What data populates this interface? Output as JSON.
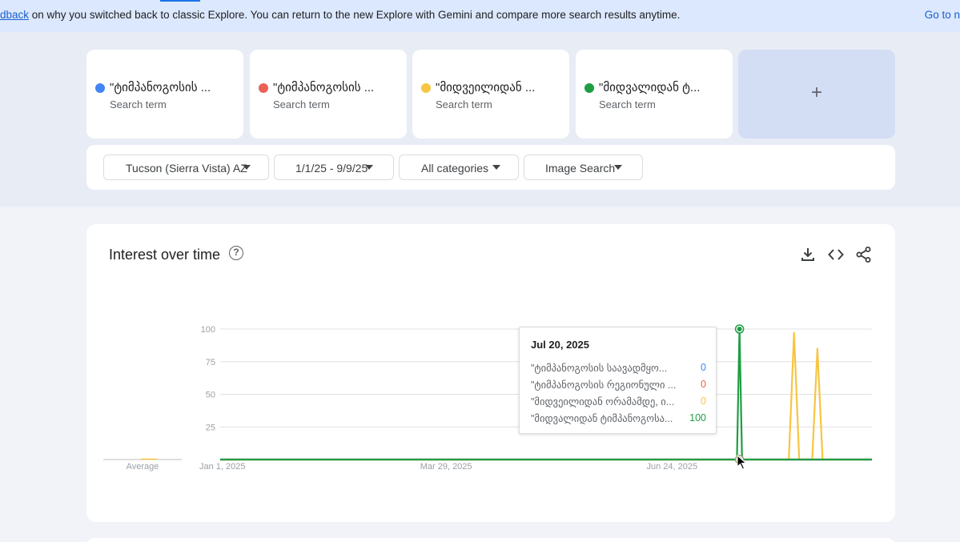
{
  "banner": {
    "link_text": "dback",
    "message": " on why you switched back to classic Explore. You can return to the new Explore with Gemini and compare more search results anytime.",
    "right_link": "Go to n"
  },
  "terms": [
    {
      "name": "\"ტიმპანოგოსის ...",
      "type": "Search term",
      "color": "#4285f4"
    },
    {
      "name": "\"ტიმპანოგოსის ...",
      "type": "Search term",
      "color": "#ea6257"
    },
    {
      "name": "\"მიდვეილიდან ...",
      "type": "Search term",
      "color": "#f7c542"
    },
    {
      "name": "\"მიდვალიდან ტ...",
      "type": "Search term",
      "color": "#1e9e43"
    }
  ],
  "add_term": {
    "icon": "plus-icon",
    "label": "+"
  },
  "filters": {
    "location": "Tucson (Sierra Vista) AZ",
    "date_range": "1/1/25 - 9/9/25",
    "category": "All categories",
    "search_type": "Image Search"
  },
  "interest": {
    "title": "Interest over time",
    "help_symbol": "?",
    "icons": [
      "download-icon",
      "embed-icon",
      "share-icon"
    ],
    "average_label": "Average"
  },
  "chart_data": {
    "type": "line",
    "title": "Interest over time",
    "ylim": [
      0,
      100
    ],
    "yticks": [
      25,
      50,
      75,
      100
    ],
    "xlim": [
      "2025-01-01",
      "2025-09-09"
    ],
    "xticks": [
      {
        "date": "2025-01-01",
        "label": "Jan 1, 2025"
      },
      {
        "date": "2025-03-29",
        "label": "Mar 29, 2025"
      },
      {
        "date": "2025-06-24",
        "label": "Jun 24, 2025"
      }
    ],
    "grid": true,
    "series": [
      {
        "name": "\"ტიმპანოგოსის საავადმყო...",
        "color": "#4285f4",
        "points": [
          [
            "2025-01-01",
            0
          ],
          [
            "2025-09-09",
            0
          ]
        ]
      },
      {
        "name": "\"ტიმპანოგოსის რეგიონული ...",
        "color": "#ea6257",
        "points": [
          [
            "2025-01-01",
            0
          ],
          [
            "2025-09-09",
            0
          ]
        ]
      },
      {
        "name": "\"მიდვეილიდან ორამამდე, ი...",
        "color": "#f7c542",
        "points": [
          [
            "2025-01-01",
            0
          ],
          [
            "2025-08-08",
            0
          ],
          [
            "2025-08-10",
            97
          ],
          [
            "2025-08-12",
            0
          ],
          [
            "2025-08-17",
            0
          ],
          [
            "2025-08-19",
            85
          ],
          [
            "2025-08-21",
            0
          ],
          [
            "2025-09-09",
            0
          ]
        ]
      },
      {
        "name": "\"მიდვალიდან ტიმპანოგოსა...",
        "color": "#1e9e43",
        "points": [
          [
            "2025-01-01",
            0
          ],
          [
            "2025-07-19",
            0
          ],
          [
            "2025-07-20",
            100
          ],
          [
            "2025-07-21",
            0
          ],
          [
            "2025-09-09",
            0
          ]
        ]
      }
    ],
    "tooltip": {
      "date": "Jul 20, 2025",
      "rows": [
        {
          "name": "\"ტიმპანოგოსის საავადმყო...",
          "value": "0",
          "color": "#4285f4"
        },
        {
          "name": "\"ტიმპანოგოსის რეგიონული ...",
          "value": "0",
          "color": "#ea6257"
        },
        {
          "name": "\"მიდვეილიდან ორამამდე, ი...",
          "value": "0",
          "color": "#f7c542"
        },
        {
          "name": "\"მიდვალიდან ტიმპანოგოსა...",
          "value": "100",
          "color": "#1e9e43"
        }
      ]
    }
  }
}
